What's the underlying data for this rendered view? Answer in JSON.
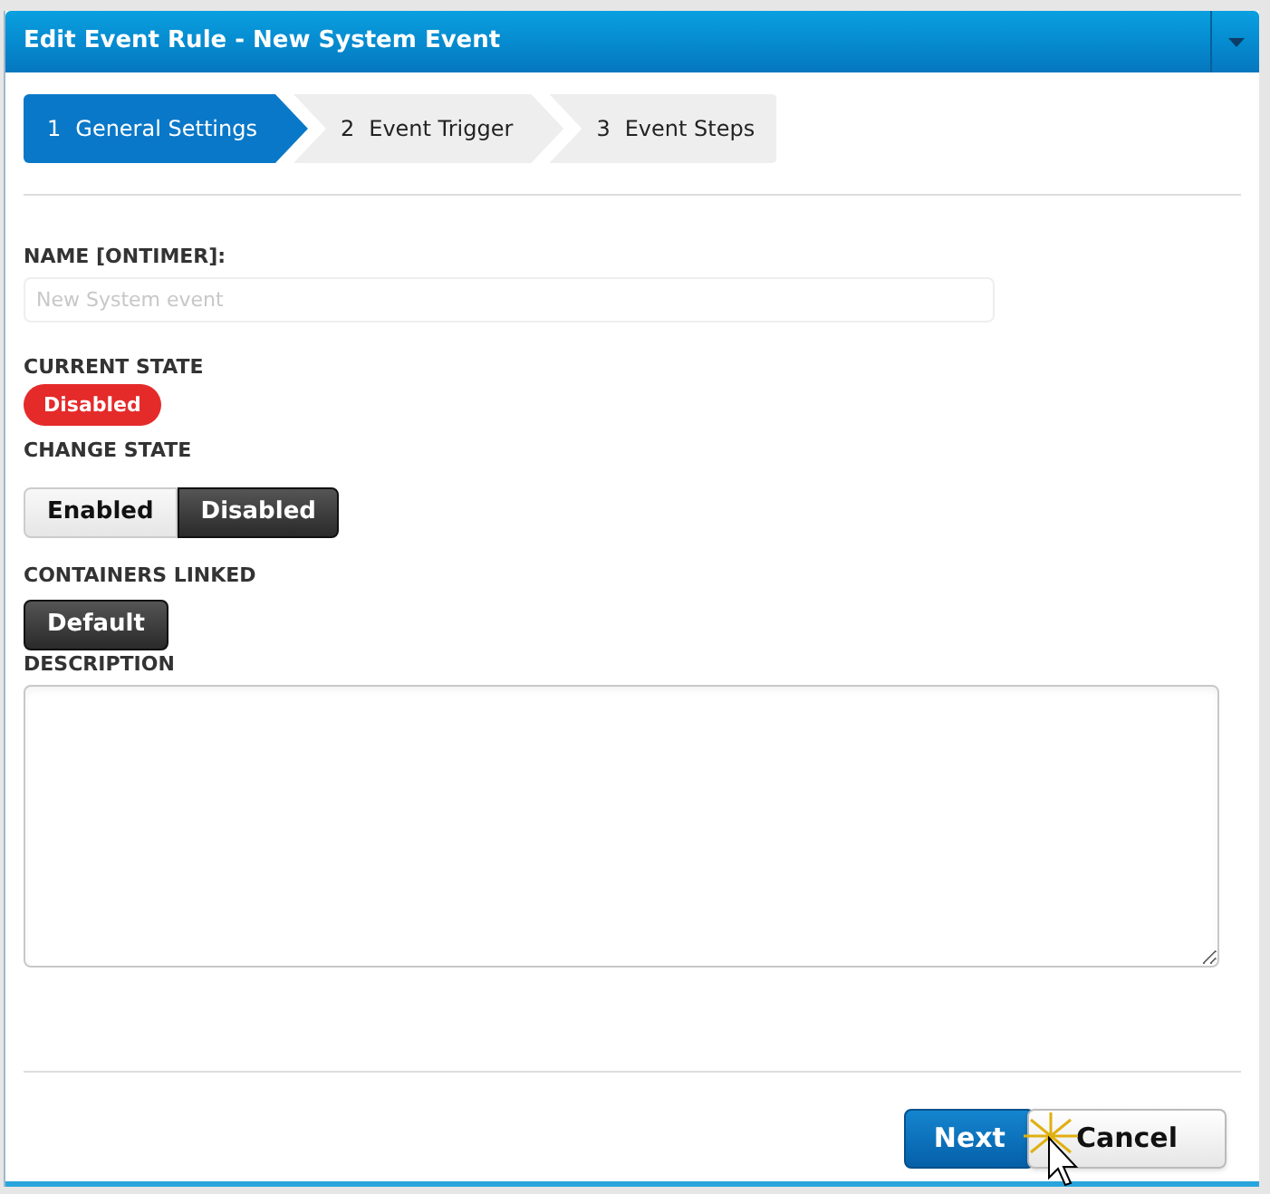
{
  "window": {
    "title": "Edit Event Rule - New System Event"
  },
  "steps": [
    {
      "number": "1",
      "label": "General Settings",
      "selected": true
    },
    {
      "number": "2",
      "label": "Event Trigger",
      "selected": false
    },
    {
      "number": "3",
      "label": "Event Steps",
      "selected": false
    }
  ],
  "name_field": {
    "label": "NAME [ONTIMER]:",
    "placeholder": "New System event"
  },
  "current_state": {
    "label": "CURRENT STATE",
    "badge": "Disabled"
  },
  "change_state": {
    "label": "CHANGE STATE",
    "options": [
      {
        "label": "Enabled",
        "selected": false
      },
      {
        "label": "Disabled",
        "selected": true
      }
    ]
  },
  "containers": {
    "label": "CONTAINERS LINKED",
    "items": [
      {
        "label": "Default",
        "selected": true
      }
    ]
  },
  "description": {
    "label": "DESCRIPTION"
  },
  "buttons": [
    {
      "label": "Next",
      "kind": "primary"
    },
    {
      "label": "Cancel",
      "kind": "secondary"
    }
  ]
}
